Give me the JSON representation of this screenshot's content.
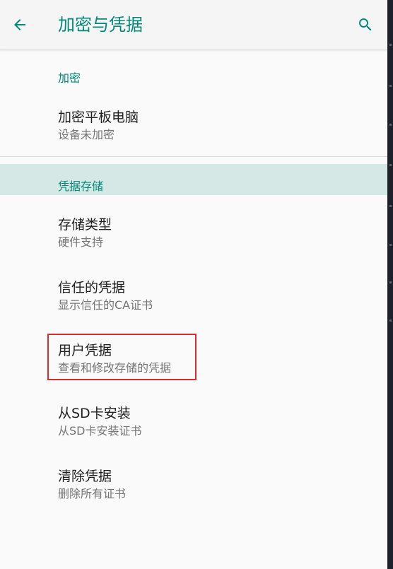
{
  "header": {
    "title": "加密与凭据",
    "back_icon": "arrow-back-icon",
    "search_icon": "search-icon",
    "accent_color": "#00897b"
  },
  "sections": [
    {
      "header": "加密",
      "items": [
        {
          "title": "加密平板电脑",
          "subtitle": "设备未加密"
        }
      ]
    },
    {
      "header": "凭据存储",
      "items": [
        {
          "title": "存储类型",
          "subtitle": "硬件支持"
        },
        {
          "title": "信任的凭据",
          "subtitle": "显示信任的CA证书"
        },
        {
          "title": "用户凭据",
          "subtitle": "查看和修改存储的凭据"
        },
        {
          "title": "从SD卡安装",
          "subtitle": "从SD卡安装证书"
        },
        {
          "title": "清除凭据",
          "subtitle": "删除所有证书"
        }
      ]
    }
  ],
  "highlight_color": "#d32f2f"
}
